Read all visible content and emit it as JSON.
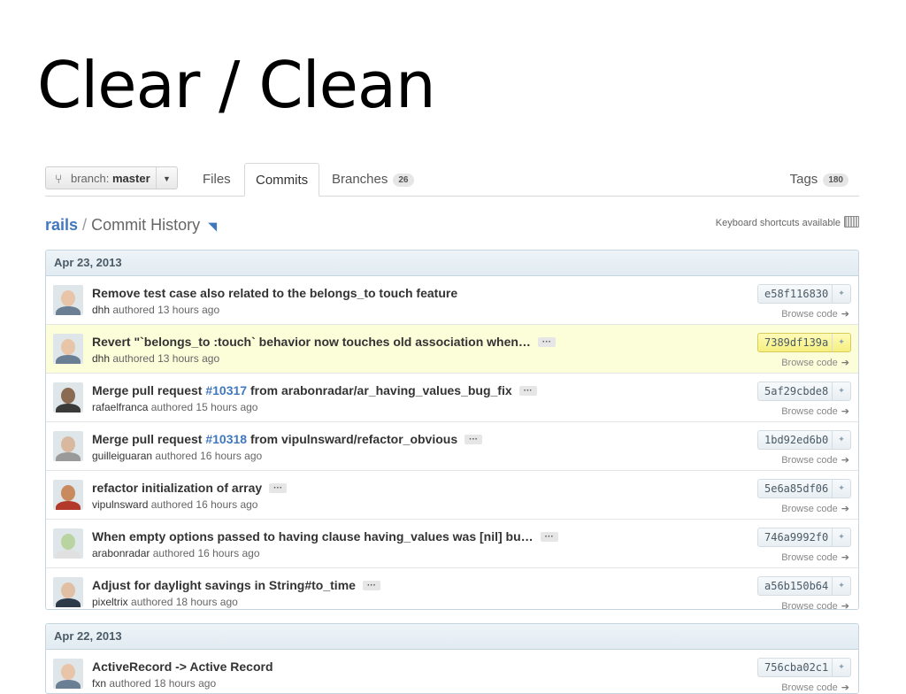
{
  "slide": {
    "title": "Clear / Clean"
  },
  "tabbar": {
    "branch_label": "branch:",
    "branch_name": "master",
    "tabs": {
      "files": "Files",
      "commits": "Commits",
      "branches": "Branches",
      "branches_count": "26",
      "tags": "Tags",
      "tags_count": "180"
    }
  },
  "repo": {
    "name": "rails",
    "separator": "/",
    "title": "Commit History",
    "keyboard_hint": "Keyboard shortcuts available"
  },
  "browse_label": "Browse code",
  "groups": [
    {
      "date": "Apr 23, 2013",
      "commits": [
        {
          "msg_pre": "Remove test case also related to the belongs_to touch feature",
          "pr": "",
          "msg_post": "",
          "author": "dhh",
          "time": "authored 13 hours ago",
          "sha": "e58f116830"
        },
        {
          "msg_pre": "Revert \"`belongs_to :touch` behavior now touches old association when…",
          "pr": "",
          "msg_post": "",
          "author": "dhh",
          "time": "authored 13 hours ago",
          "sha": "7389df139a"
        },
        {
          "msg_pre": "Merge pull request ",
          "pr": "#10317",
          "msg_post": " from arabonradar/ar_having_values_bug_fix",
          "author": "rafaelfranca",
          "time": "authored 15 hours ago",
          "sha": "5af29cbde8"
        },
        {
          "msg_pre": "Merge pull request ",
          "pr": "#10318",
          "msg_post": " from vipulnsward/refactor_obvious",
          "author": "guilleiguaran",
          "time": "authored 16 hours ago",
          "sha": "1bd92ed6b0"
        },
        {
          "msg_pre": "refactor initialization of array",
          "pr": "",
          "msg_post": "",
          "author": "vipulnsward",
          "time": "authored 16 hours ago",
          "sha": "5e6a85df06"
        },
        {
          "msg_pre": "When empty options passed to having clause having_values was [nil] bu…",
          "pr": "",
          "msg_post": "",
          "author": "arabonradar",
          "time": "authored 16 hours ago",
          "sha": "746a9992f0"
        },
        {
          "msg_pre": "Adjust for daylight savings in String#to_time",
          "pr": "",
          "msg_post": "",
          "author": "pixeltrix",
          "time": "authored 18 hours ago",
          "sha": "a56b150b64"
        }
      ]
    },
    {
      "date": "Apr 22, 2013",
      "commits": [
        {
          "msg_pre": "ActiveRecord -> Active Record",
          "pr": "",
          "msg_post": "",
          "author": "fxn",
          "time": "authored 18 hours ago",
          "sha": "756cba02c1"
        }
      ]
    }
  ],
  "icons": {
    "branch": "⑂",
    "caret": "▼",
    "rss": "◥",
    "ellipsis": "···",
    "sha_copy": "✦",
    "arrow": "➔"
  },
  "colors": {
    "link": "#4078c0",
    "highlight_row": "#fcfdd9",
    "group_header": "#e1ebf1"
  }
}
